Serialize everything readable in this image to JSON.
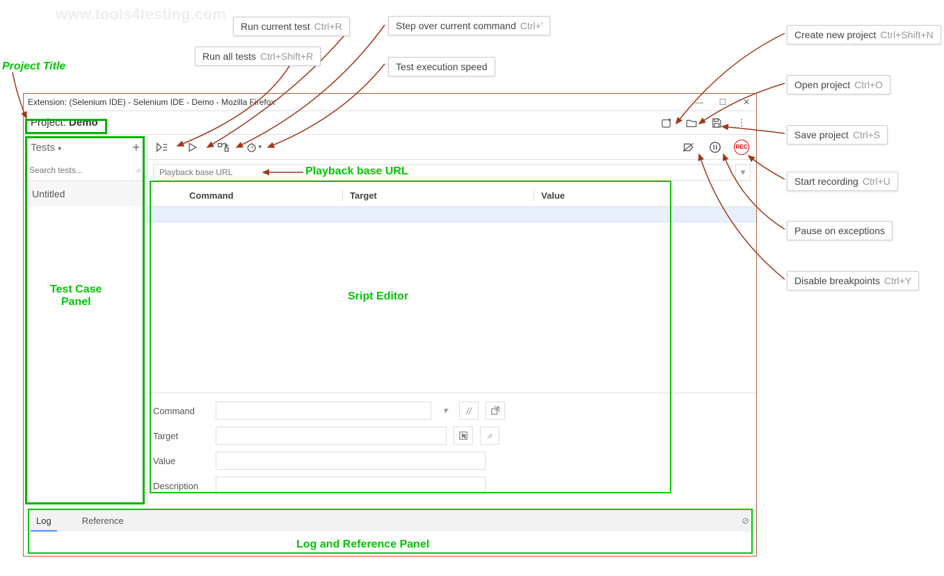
{
  "watermarks": [
    "www.tools4testing.com",
    "www.tools4testing.com",
    "www.tools4testing.com",
    "www.tools4testing.com"
  ],
  "callouts": {
    "run_current": {
      "label": "Run current test",
      "shortcut": "Ctrl+R"
    },
    "run_all": {
      "label": "Run all tests",
      "shortcut": "Ctrl+Shift+R"
    },
    "step_over": {
      "label": "Step over current command",
      "shortcut": "Ctrl+'"
    },
    "test_speed": {
      "label": "Test execution speed",
      "shortcut": ""
    },
    "create_new": {
      "label": "Create new project",
      "shortcut": "Ctrl+Shift+N"
    },
    "open_proj": {
      "label": "Open project",
      "shortcut": "Ctrl+O"
    },
    "save_proj": {
      "label": "Save project",
      "shortcut": "Ctrl+S"
    },
    "start_rec": {
      "label": "Start recording",
      "shortcut": "Ctrl+U"
    },
    "pause_exc": {
      "label": "Pause on exceptions",
      "shortcut": ""
    },
    "disable_bp": {
      "label": "Disable breakpoints",
      "shortcut": "Ctrl+Y"
    }
  },
  "green_labels": {
    "project_title": "Project Title",
    "playback_url": "Playback base URL",
    "test_case_panel": "Test Case\nPanel",
    "script_editor": "Sript Editor",
    "log_ref_panel": "Log and Reference Panel"
  },
  "window": {
    "title": "Extension: (Selenium IDE) - Selenium IDE - Demo - Mozilla Firefox",
    "project_label": "Project:",
    "project_name": "Demo"
  },
  "sidebar": {
    "tests_label": "Tests",
    "search_placeholder": "Search tests...",
    "items": [
      "Untitled"
    ]
  },
  "editor": {
    "url_placeholder": "Playback base URL",
    "columns": {
      "command": "Command",
      "target": "Target",
      "value": "Value"
    },
    "form": {
      "command": "Command",
      "target": "Target",
      "value": "Value",
      "description": "Description"
    }
  },
  "bottom": {
    "tabs": {
      "log": "Log",
      "reference": "Reference"
    }
  }
}
